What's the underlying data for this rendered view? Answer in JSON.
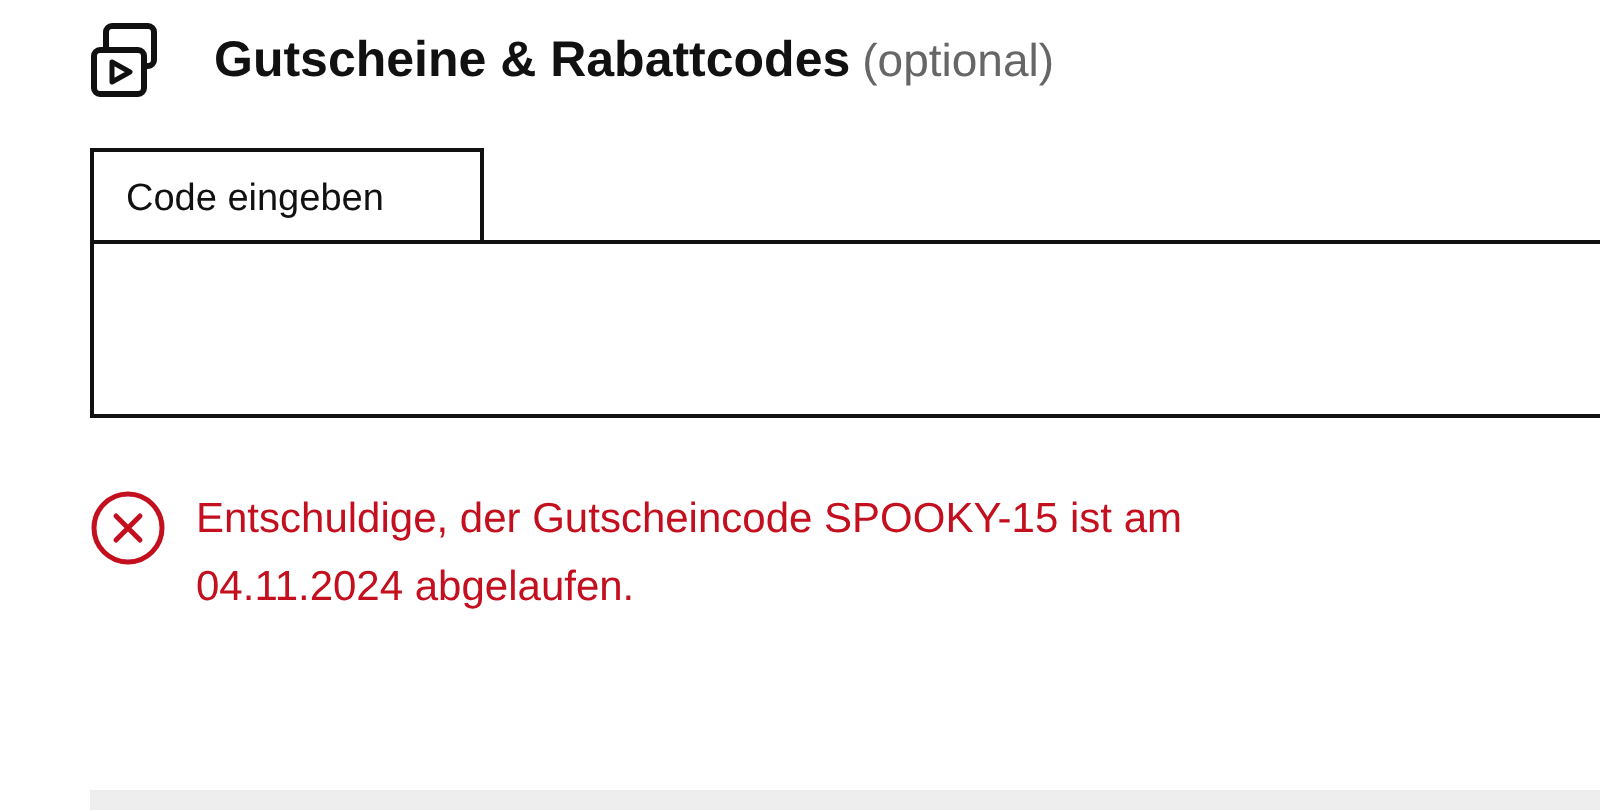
{
  "heading": {
    "title": "Gutscheine & Rabattcodes",
    "note": "(optional)"
  },
  "code_field": {
    "label": "Code eingeben"
  },
  "error": {
    "message": "Entschuldige, der Gutscheincode SPOOKY-15 ist am 04.11.2024 abgelaufen."
  }
}
